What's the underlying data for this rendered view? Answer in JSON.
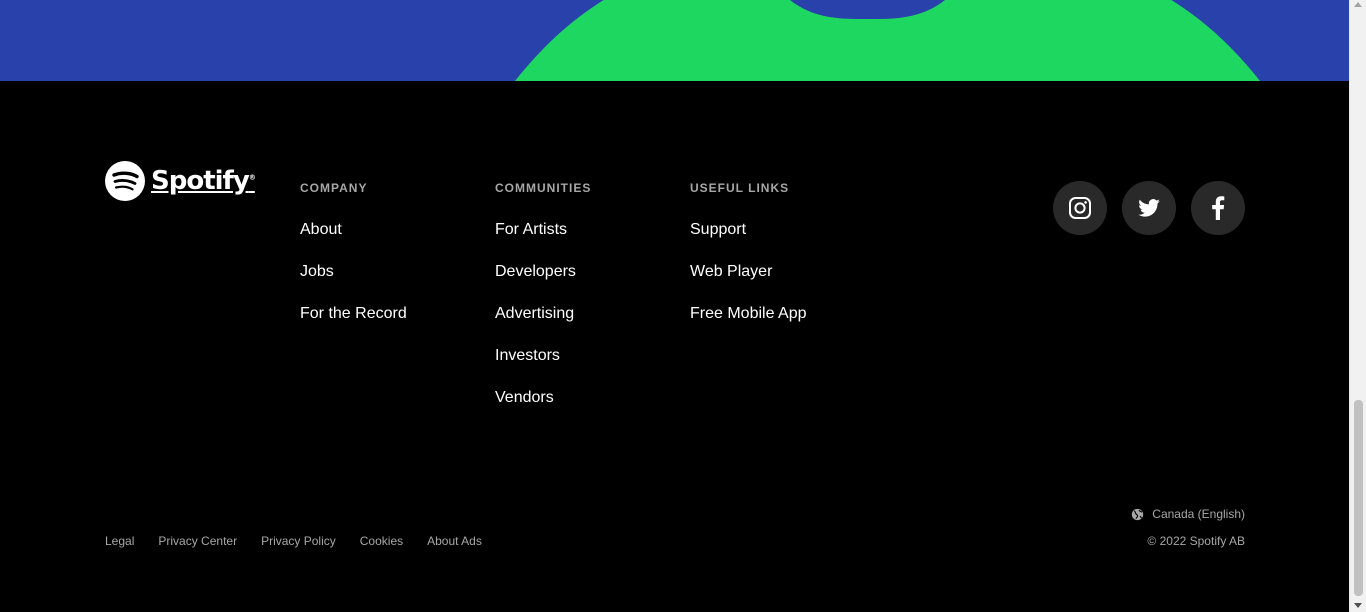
{
  "colors": {
    "hero_background": "#2941ab",
    "hero_arc": "#1ed760",
    "footer_background": "#000000",
    "muted_text": "#a7a7a7",
    "social_button": "#292929"
  },
  "brand": {
    "name": "Spotify",
    "tm": "®",
    "icon": "spotify-logo-icon"
  },
  "columns": [
    {
      "heading": "COMPANY",
      "links": [
        "About",
        "Jobs",
        "For the Record"
      ]
    },
    {
      "heading": "COMMUNITIES",
      "links": [
        "For Artists",
        "Developers",
        "Advertising",
        "Investors",
        "Vendors"
      ]
    },
    {
      "heading": "USEFUL LINKS",
      "links": [
        "Support",
        "Web Player",
        "Free Mobile App"
      ]
    }
  ],
  "socials": [
    {
      "icon": "instagram-icon"
    },
    {
      "icon": "twitter-icon"
    },
    {
      "icon": "facebook-icon"
    }
  ],
  "legal_links": [
    "Legal",
    "Privacy Center",
    "Privacy Policy",
    "Cookies",
    "About Ads"
  ],
  "locale": {
    "icon": "globe-icon",
    "label": "Canada (English)"
  },
  "copyright": "© 2022 Spotify AB"
}
